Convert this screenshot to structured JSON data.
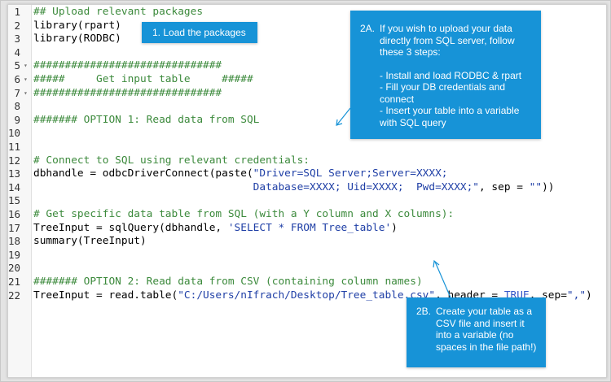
{
  "code_lines": [
    {
      "num": "1",
      "fold": false,
      "tokens": [
        {
          "t": "## Upload relevant packages",
          "c": "comment"
        }
      ]
    },
    {
      "num": "2",
      "fold": false,
      "tokens": [
        {
          "t": "library(rpart)",
          "c": "func"
        }
      ]
    },
    {
      "num": "3",
      "fold": false,
      "tokens": [
        {
          "t": "library(RODBC)",
          "c": "func"
        }
      ]
    },
    {
      "num": "4",
      "fold": false,
      "tokens": []
    },
    {
      "num": "5",
      "fold": true,
      "tokens": [
        {
          "t": "##############################",
          "c": "comment"
        }
      ]
    },
    {
      "num": "6",
      "fold": true,
      "tokens": [
        {
          "t": "#####     Get input table     #####",
          "c": "comment"
        }
      ]
    },
    {
      "num": "7",
      "fold": true,
      "tokens": [
        {
          "t": "##############################",
          "c": "comment"
        }
      ]
    },
    {
      "num": "8",
      "fold": false,
      "tokens": []
    },
    {
      "num": "9",
      "fold": false,
      "tokens": [
        {
          "t": "####### OPTION 1: Read data from SQL",
          "c": "comment"
        }
      ]
    },
    {
      "num": "10",
      "fold": false,
      "tokens": []
    },
    {
      "num": "11",
      "fold": false,
      "tokens": []
    },
    {
      "num": "12",
      "fold": false,
      "tokens": [
        {
          "t": "# Connect to SQL using relevant credentials:",
          "c": "comment"
        }
      ]
    },
    {
      "num": "13",
      "fold": false,
      "tokens": [
        {
          "t": "dbhandle = odbcDriverConnect(paste(",
          "c": "func"
        },
        {
          "t": "\"Driver=SQL Server;Server=XXXX;",
          "c": "string"
        }
      ]
    },
    {
      "num": "14",
      "fold": false,
      "tokens": [
        {
          "t": "                                   ",
          "c": "func"
        },
        {
          "t": "Database=XXXX; Uid=XXXX;  Pwd=XXXX;\"",
          "c": "string"
        },
        {
          "t": ", sep = ",
          "c": "func"
        },
        {
          "t": "\"\"",
          "c": "string"
        },
        {
          "t": "))",
          "c": "func"
        }
      ]
    },
    {
      "num": "15",
      "fold": false,
      "tokens": []
    },
    {
      "num": "16",
      "fold": false,
      "tokens": [
        {
          "t": "# Get specific data table from SQL (with a Y column and X columns):",
          "c": "comment"
        }
      ]
    },
    {
      "num": "17",
      "fold": false,
      "tokens": [
        {
          "t": "TreeInput = sqlQuery(dbhandle, ",
          "c": "func"
        },
        {
          "t": "'SELECT * FROM Tree_table'",
          "c": "string"
        },
        {
          "t": ")",
          "c": "func"
        }
      ]
    },
    {
      "num": "18",
      "fold": false,
      "tokens": [
        {
          "t": "summary(TreeInput)",
          "c": "func"
        }
      ]
    },
    {
      "num": "19",
      "fold": false,
      "tokens": []
    },
    {
      "num": "20",
      "fold": false,
      "tokens": []
    },
    {
      "num": "21",
      "fold": false,
      "tokens": [
        {
          "t": "####### OPTION 2: Read data from CSV (containing column names)",
          "c": "comment"
        }
      ]
    },
    {
      "num": "22",
      "fold": false,
      "tokens": [
        {
          "t": "TreeInput = read.table(",
          "c": "func"
        },
        {
          "t": "\"C:/Users/nIfrach/Desktop/Tree_table.csv\"",
          "c": "string"
        },
        {
          "t": ", header = ",
          "c": "func"
        },
        {
          "t": "TRUE",
          "c": "const"
        },
        {
          "t": ", sep=",
          "c": "func"
        },
        {
          "t": "\",\"",
          "c": "string"
        },
        {
          "t": ")",
          "c": "func"
        }
      ]
    }
  ],
  "callouts": {
    "one": {
      "num": "",
      "text": "1. Load the packages"
    },
    "two_a": {
      "num": "2A.",
      "intro": "If you wish to upload your data directly from SQL server, follow these 3 steps:",
      "steps": [
        "- Install and load RODBC & rpart",
        "- Fill your DB credentials and connect",
        "- Insert your table into a variable with SQL query"
      ]
    },
    "two_b": {
      "num": "2B.",
      "text": "Create your table as a CSV file and insert it into a variable (no spaces in the file path!)"
    }
  },
  "colors": {
    "comment": "#3c8a3c",
    "string": "#1f3fa6",
    "constant": "#3457c8",
    "callout_bg": "#1793d7"
  }
}
